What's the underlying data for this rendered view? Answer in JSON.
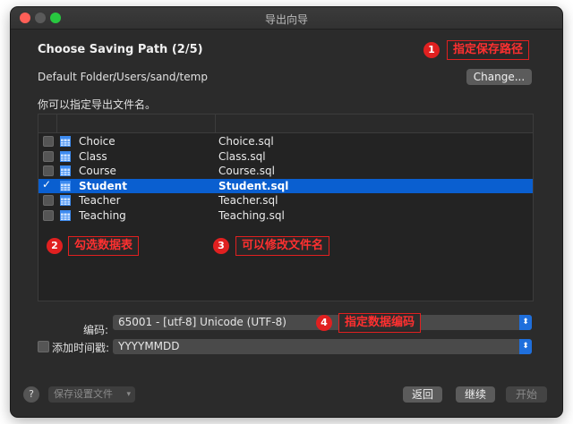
{
  "window": {
    "title": "导出向导"
  },
  "heading": "Choose Saving Path (2/5)",
  "default_folder": {
    "label": "Default Folder:",
    "path": "/Users/sand/temp",
    "change_button": "Change..."
  },
  "hint": "你可以指定导出文件名。",
  "rows": [
    {
      "name": "Choice",
      "file": "Choice.sql",
      "checked": false,
      "selected": false
    },
    {
      "name": "Class",
      "file": "Class.sql",
      "checked": false,
      "selected": false
    },
    {
      "name": "Course",
      "file": "Course.sql",
      "checked": false,
      "selected": false
    },
    {
      "name": "Student",
      "file": "Student.sql",
      "checked": true,
      "selected": true
    },
    {
      "name": "Teacher",
      "file": "Teacher.sql",
      "checked": false,
      "selected": false
    },
    {
      "name": "Teaching",
      "file": "Teaching.sql",
      "checked": false,
      "selected": false
    }
  ],
  "encoding": {
    "label": "编码:",
    "value": "65001 - [utf-8] Unicode (UTF-8)"
  },
  "timestamp": {
    "label": "添加时间戳:",
    "value": "YYYYMMDD",
    "checked": false
  },
  "footer": {
    "help": "?",
    "save_settings": "保存设置文件",
    "back": "返回",
    "next": "继续",
    "start": "开始"
  },
  "annotations": [
    {
      "num": "1",
      "text": "指定保存路径"
    },
    {
      "num": "2",
      "text": "勾选数据表"
    },
    {
      "num": "3",
      "text": "可以修改文件名"
    },
    {
      "num": "4",
      "text": "指定数据编码"
    }
  ],
  "colors": {
    "accent": "#0a5fd0",
    "annotation": "#e02020",
    "window_bg": "#2b2b2b"
  }
}
